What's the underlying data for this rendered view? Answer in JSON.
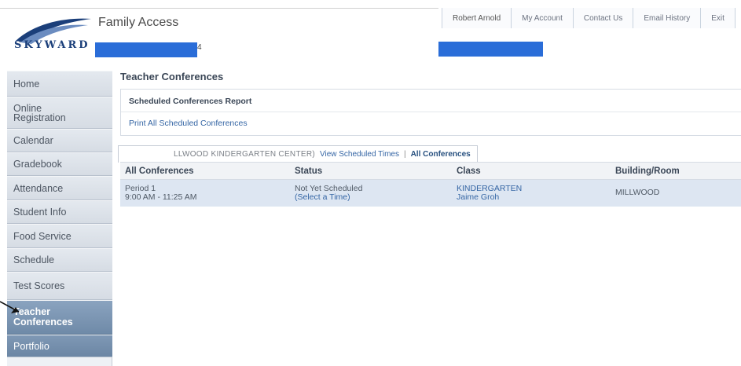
{
  "header": {
    "app_title": "Family Access",
    "logo_text": "SKYWARD",
    "redaction_mark": "4",
    "top_nav": [
      "Robert Arnold",
      "My Account",
      "Contact Us",
      "Email History",
      "Exit"
    ]
  },
  "sidebar": {
    "items": [
      {
        "label": "Home"
      },
      {
        "label": "Online Registration"
      },
      {
        "label": "Calendar"
      },
      {
        "label": "Gradebook"
      },
      {
        "label": "Attendance"
      },
      {
        "label": "Student Info"
      },
      {
        "label": "Food Service"
      },
      {
        "label": "Schedule"
      },
      {
        "label": "Test Scores"
      },
      {
        "label": "Teacher Conferences",
        "active": true
      },
      {
        "label": "Portfolio"
      }
    ]
  },
  "main": {
    "page_title": "Teacher Conferences",
    "report": {
      "title": "Scheduled Conferences Report",
      "link": "Print All Scheduled Conferences"
    },
    "tabs": {
      "school": "LLWOOD KINDERGARTEN CENTER)",
      "view_times": "View Scheduled Times",
      "separator": "|",
      "current": "All Conferences"
    },
    "table": {
      "headers": [
        "All Conferences",
        "Status",
        "Class",
        "Building/Room"
      ],
      "rows": [
        {
          "period": "Period 1",
          "time": "9:00 AM - 11:25 AM",
          "status": "Not Yet Scheduled",
          "status_link": "(Select a Time)",
          "class": "KINDERGARTEN",
          "teacher": "Jaime Groh",
          "building": "MILLWOOD"
        }
      ]
    }
  },
  "colors": {
    "accent_link": "#3465a4",
    "active_nav": "#7a94b2",
    "redaction": "#2a6dd8",
    "row_highlight": "#dde6f2"
  }
}
